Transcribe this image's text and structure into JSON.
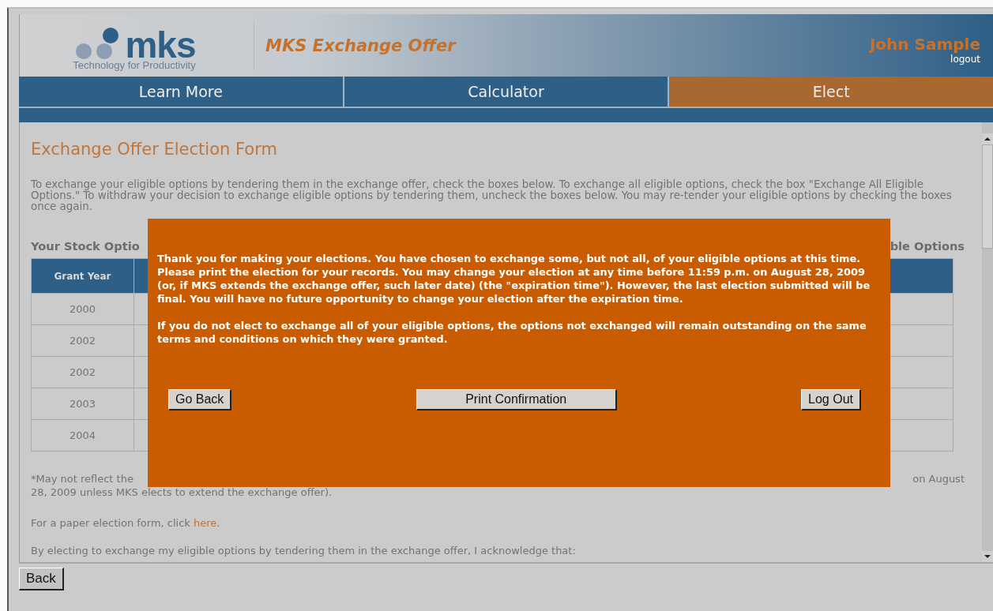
{
  "header": {
    "logo_text": "mks",
    "tagline": "Technology for Productivity",
    "title": "MKS Exchange Offer",
    "user": "John Sample",
    "logout": "logout"
  },
  "tabs": [
    {
      "label": "Learn More",
      "selected": false
    },
    {
      "label": "Calculator",
      "selected": false
    },
    {
      "label": "Elect",
      "selected": true
    }
  ],
  "form": {
    "title": "Exchange Offer Election Form",
    "intro": "To exchange your eligible options by tendering them in the exchange offer, check the boxes below. To exchange all eligible options, check the box \"Exchange All Eligible Options.\" To withdraw your decision to exchange eligible options by tendering them, uncheck the boxes below. You may re-tender your eligible options by checking the boxes once again.",
    "section_left": "Your Stock Optio",
    "section_right": "ble Options",
    "table": {
      "columns": [
        "Grant Year"
      ],
      "rows": [
        [
          "2000"
        ],
        [
          "2002"
        ],
        [
          "2002"
        ],
        [
          "2003"
        ],
        [
          "2004"
        ]
      ]
    },
    "footnote_left": "*May not reflect the",
    "footnote_right": "on August",
    "footnote_line2": "28, 2009 unless MKS elects to extend the exchange offer).",
    "paper_text": "For a paper election form, click ",
    "paper_link": "here",
    "paper_end": ".",
    "acknowledge": "By electing to exchange my eligible options by tendering them in the exchange offer, I acknowledge that:"
  },
  "modal": {
    "paragraphs": [
      "Thank you for making your elections. You have chosen to exchange some, but not all, of your eligible options at this time. Please print the election for your records. You may change your election at any time before 11:59 p.m. on August 28, 2009 (or, if MKS extends the exchange offer, such later date) (the \"expiration time\"). However, the last election submitted will be final. You will have no future opportunity to change your election after the expiration time.",
      "If you do not elect to exchange all of your eligible options, the options not exchanged will remain outstanding on the same terms and conditions on which they were granted."
    ],
    "buttons": [
      "Go Back",
      "Print Confirmation",
      "Log Out"
    ]
  },
  "back_button": "Back"
}
